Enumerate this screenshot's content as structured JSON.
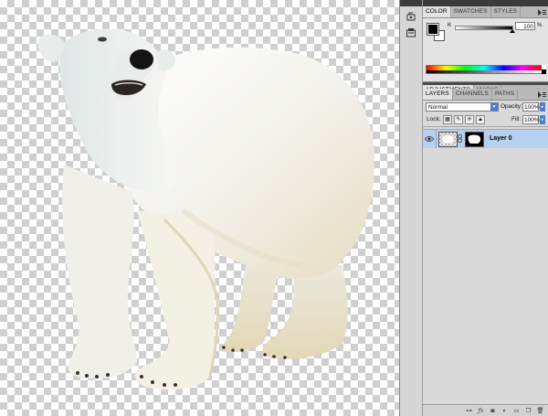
{
  "color_panel": {
    "tabs": [
      "COLOR",
      "SWATCHES",
      "STYLES"
    ],
    "active_tab": "COLOR",
    "slider_label": "K",
    "slider_value": "100",
    "slider_unit": "%"
  },
  "adjustments_panel": {
    "tabs": [
      "ADJUSTMENTS",
      "MASKS"
    ]
  },
  "layers_panel": {
    "tabs": [
      "LAYERS",
      "CHANNELS",
      "PATHS"
    ],
    "blend_mode": "Normal",
    "opacity_label": "Opacity:",
    "opacity_value": "100%",
    "lock_label": "Lock:",
    "fill_label": "Fill:",
    "fill_value": "100%",
    "layers": [
      {
        "name": "Layer 0",
        "visible": true,
        "selected": true
      }
    ],
    "footer_icons": [
      "link-icon",
      "fx-icon",
      "add-mask-icon",
      "adjustment-layer-icon",
      "new-group-icon",
      "new-layer-icon",
      "trash-icon"
    ]
  },
  "colors": {
    "selection_highlight": "#b8d0ef",
    "panel_bg": "#d9d9d9",
    "dark_bar": "#3b3b3b"
  }
}
